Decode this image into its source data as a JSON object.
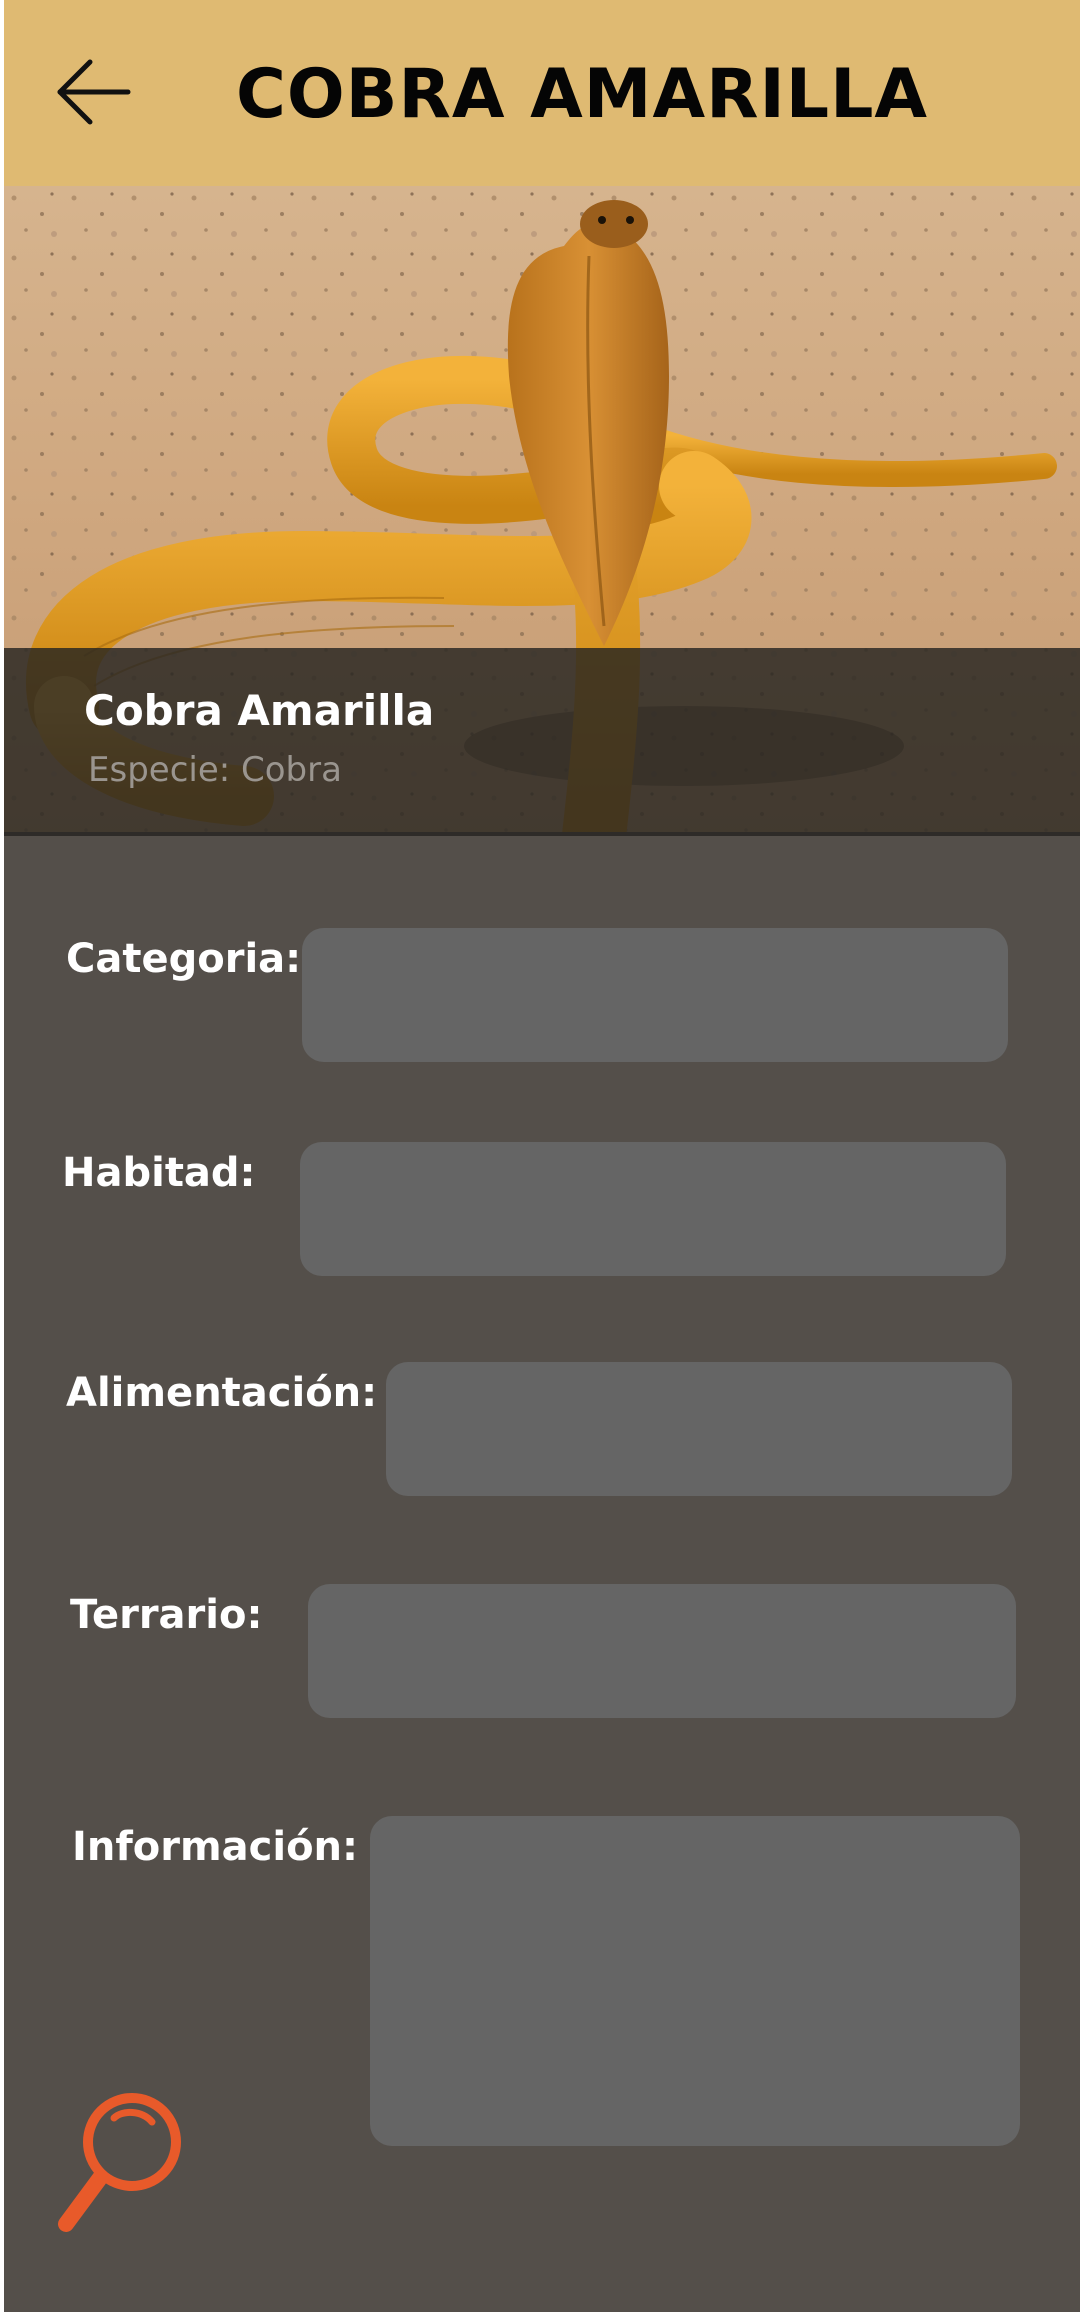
{
  "header": {
    "title": "COBRA AMARILLA",
    "back_icon": "arrow-left-icon"
  },
  "hero": {
    "name": "Cobra Amarilla",
    "species": "Especie: Cobra"
  },
  "fields": {
    "categoria": {
      "label": "Categoria:",
      "value": ""
    },
    "habitad": {
      "label": "Habitad:",
      "value": ""
    },
    "alimentacion": {
      "label": "Alimentación:",
      "value": ""
    },
    "terrario": {
      "label": "Terrario:",
      "value": ""
    },
    "informacion": {
      "label": "Información:",
      "value": ""
    }
  },
  "search": {
    "icon": "magnifier-icon"
  },
  "colors": {
    "header_bg": "#dfba72",
    "page_bg": "#544f4a",
    "field_bg": "#656565",
    "accent": "#e85a2a"
  }
}
